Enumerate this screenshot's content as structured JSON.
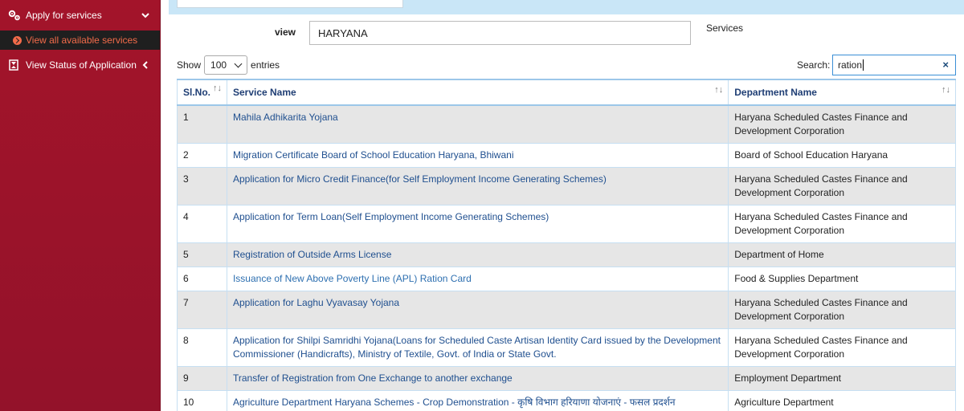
{
  "sidebar": {
    "items": [
      {
        "label": "Apply for services",
        "icon": "gears-icon",
        "chevron": "chevron-down-icon"
      },
      {
        "label": "View all available services",
        "icon": "arrow-circle-right-icon"
      },
      {
        "label": "View Status of Application",
        "icon": "hourglass-icon",
        "chevron": "chevron-left-icon"
      }
    ]
  },
  "filter": {
    "view_label": "view",
    "view_value": "HARYANA",
    "services_label": "Services"
  },
  "table_controls": {
    "show_label": "Show",
    "show_value": "100",
    "entries_label": "entries",
    "search_label": "Search:",
    "search_value": "ration",
    "clear_icon": "×"
  },
  "table": {
    "headers": [
      "Sl.No.",
      "Service Name",
      "Department Name"
    ],
    "rows": [
      {
        "sl": "1",
        "service": "Mahila Adhikarita Yojana",
        "dept": "Haryana Scheduled Castes Finance and Development Corporation"
      },
      {
        "sl": "2",
        "service": "Migration Certificate Board of School Education Haryana, Bhiwani",
        "dept": "Board of School Education Haryana"
      },
      {
        "sl": "3",
        "service": "Application for Micro Credit Finance(for Self Employment Income Generating Schemes)",
        "dept": "Haryana Scheduled Castes Finance and Development Corporation"
      },
      {
        "sl": "4",
        "service": "Application for Term Loan(Self Employment Income Generating Schemes)",
        "dept": "Haryana Scheduled Castes Finance and Development Corporation"
      },
      {
        "sl": "5",
        "service": "Registration of Outside Arms License",
        "dept": "Department of Home"
      },
      {
        "sl": "6",
        "service": "Issuance of New Above Poverty Line (APL) Ration Card",
        "dept": "Food & Supplies Department"
      },
      {
        "sl": "7",
        "service": "Application for Laghu Vyavasay Yojana",
        "dept": "Haryana Scheduled Castes Finance and Development Corporation"
      },
      {
        "sl": "8",
        "service": "Application for Shilpi Samridhi Yojana(Loans for Scheduled Caste Artisan Identity Card issued by the Development Commissioner (Handicrafts), Ministry of Textile, Govt. of India or State Govt.",
        "dept": "Haryana Scheduled Castes Finance and Development Corporation"
      },
      {
        "sl": "9",
        "service": "Transfer of Registration from One Exchange to another exchange",
        "dept": "Employment Department"
      },
      {
        "sl": "10",
        "service": "Agriculture Department Haryana Schemes - Crop Demonstration - कृषि विभाग हरियाणा योजनाएं - फसल प्रदर्शन",
        "dept": "Agriculture Department"
      }
    ]
  },
  "colors": {
    "sidebar_bg": "#a3142a",
    "active_item_bg": "#1f1f1f",
    "active_item_text": "#f26b4a",
    "link_text": "#1f4f8f",
    "header_text": "#1f3e74",
    "top_band": "#c9e6f7"
  }
}
